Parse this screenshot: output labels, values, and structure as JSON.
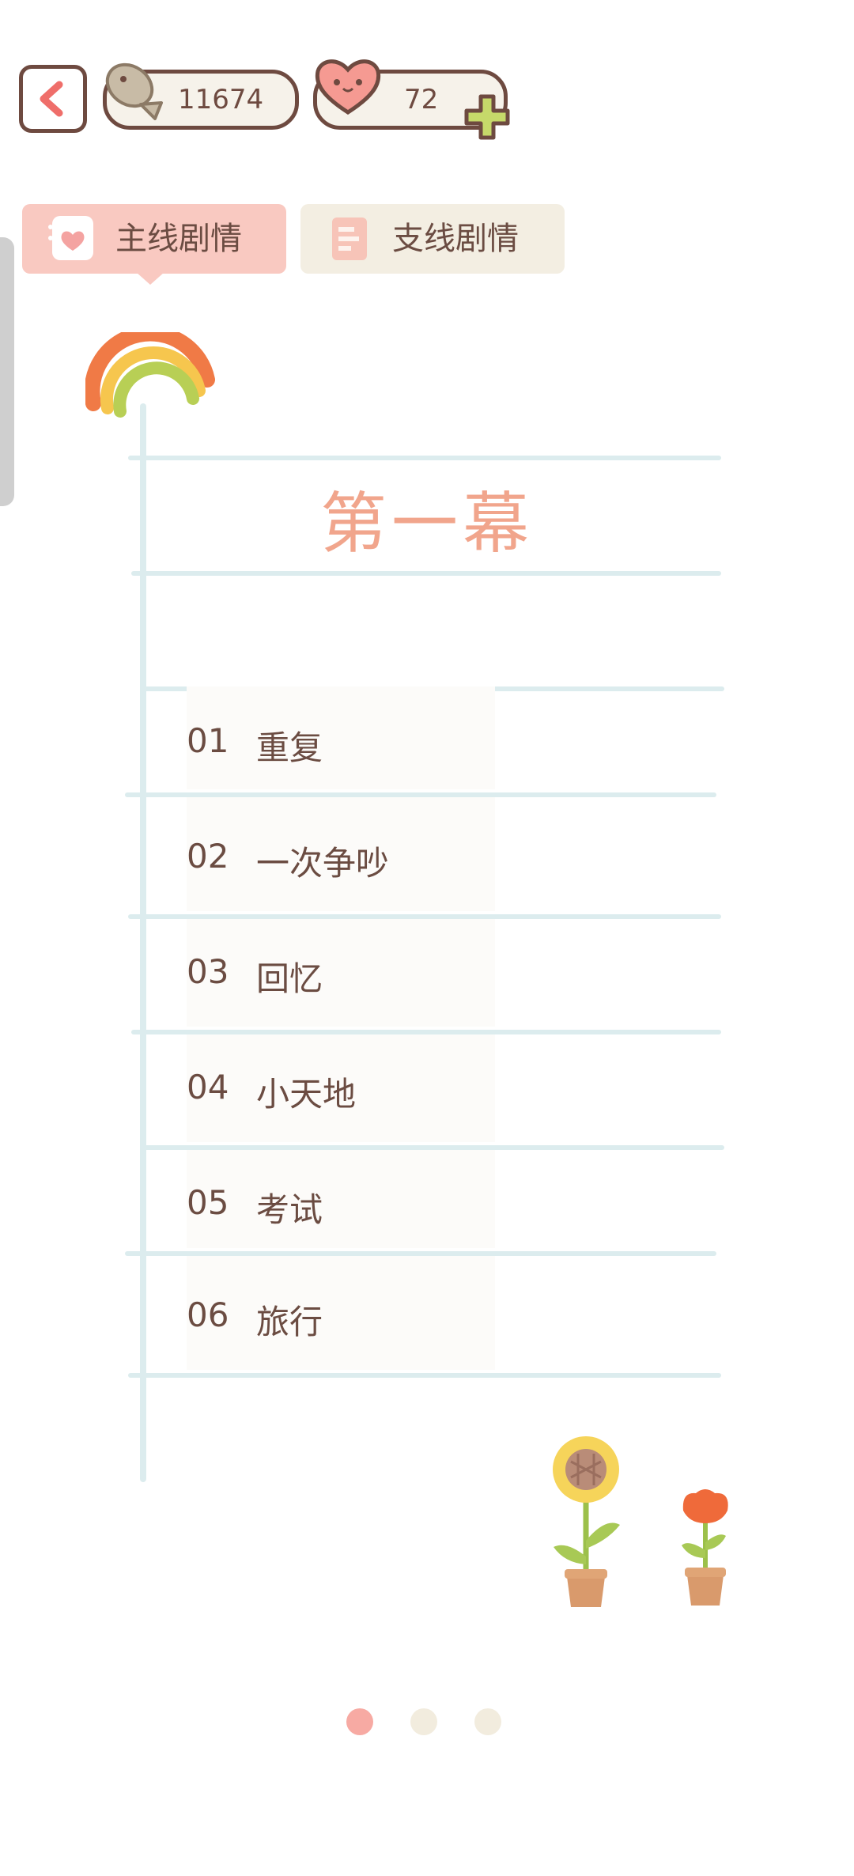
{
  "header": {
    "fish_count": "11674",
    "heart_count": "72"
  },
  "tabs": [
    {
      "label": "主线剧情",
      "active": true
    },
    {
      "label": "支线剧情",
      "active": false
    }
  ],
  "chapter": {
    "title": "第一幕",
    "episodes": [
      {
        "num": "01",
        "name": "重复"
      },
      {
        "num": "02",
        "name": "一次争吵"
      },
      {
        "num": "03",
        "name": "回忆"
      },
      {
        "num": "04",
        "name": "小天地"
      },
      {
        "num": "05",
        "name": "考试"
      },
      {
        "num": "06",
        "name": "旅行"
      }
    ]
  },
  "pagination": {
    "pages": 3,
    "current": 1
  },
  "colors": {
    "accent": "#f1a58c",
    "tab_active": "#f9c9c1",
    "tab_inactive": "#f3eee2",
    "line": "#dcecee",
    "text": "#6b4c42"
  }
}
